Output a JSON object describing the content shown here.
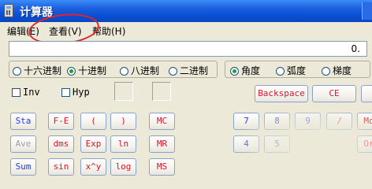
{
  "window": {
    "title": "计算器"
  },
  "menu": [
    {
      "label": "编辑(E)"
    },
    {
      "label": "查看(V)"
    },
    {
      "label": "帮助(H)"
    }
  ],
  "display": {
    "value": "0."
  },
  "number_system": {
    "options": [
      "十六进制",
      "十进制",
      "八进制",
      "二进制"
    ],
    "selected": "十进制"
  },
  "angle_units": {
    "options": [
      "角度",
      "弧度",
      "梯度"
    ],
    "selected": "角度"
  },
  "checkboxes": [
    "Inv",
    "Hyp"
  ],
  "buttons": {
    "backspace": "Backspace",
    "ce": "CE",
    "sta": "Sta",
    "fe": "F-E",
    "lparen": "(",
    "rparen": ")",
    "mc": "MC",
    "seven": "7",
    "eight": "8",
    "nine": "9",
    "divide": "/",
    "mod_partial": "Mo",
    "ave": "Ave",
    "dms": "dms",
    "exp": "Exp",
    "ln": "ln",
    "mr": "MR",
    "four": "4",
    "five": "5",
    "or_partial": "Or",
    "sum_partial": "Sum",
    "sin_partial": "sin",
    "xy_partial": "x^y",
    "log_partial": "log",
    "ms_partial": "MS"
  },
  "colors": {
    "titlebar": "#0a4fd4",
    "blue_text": "#1f3fd8",
    "red_text": "#d8162a",
    "annotation": "#e0262a"
  }
}
